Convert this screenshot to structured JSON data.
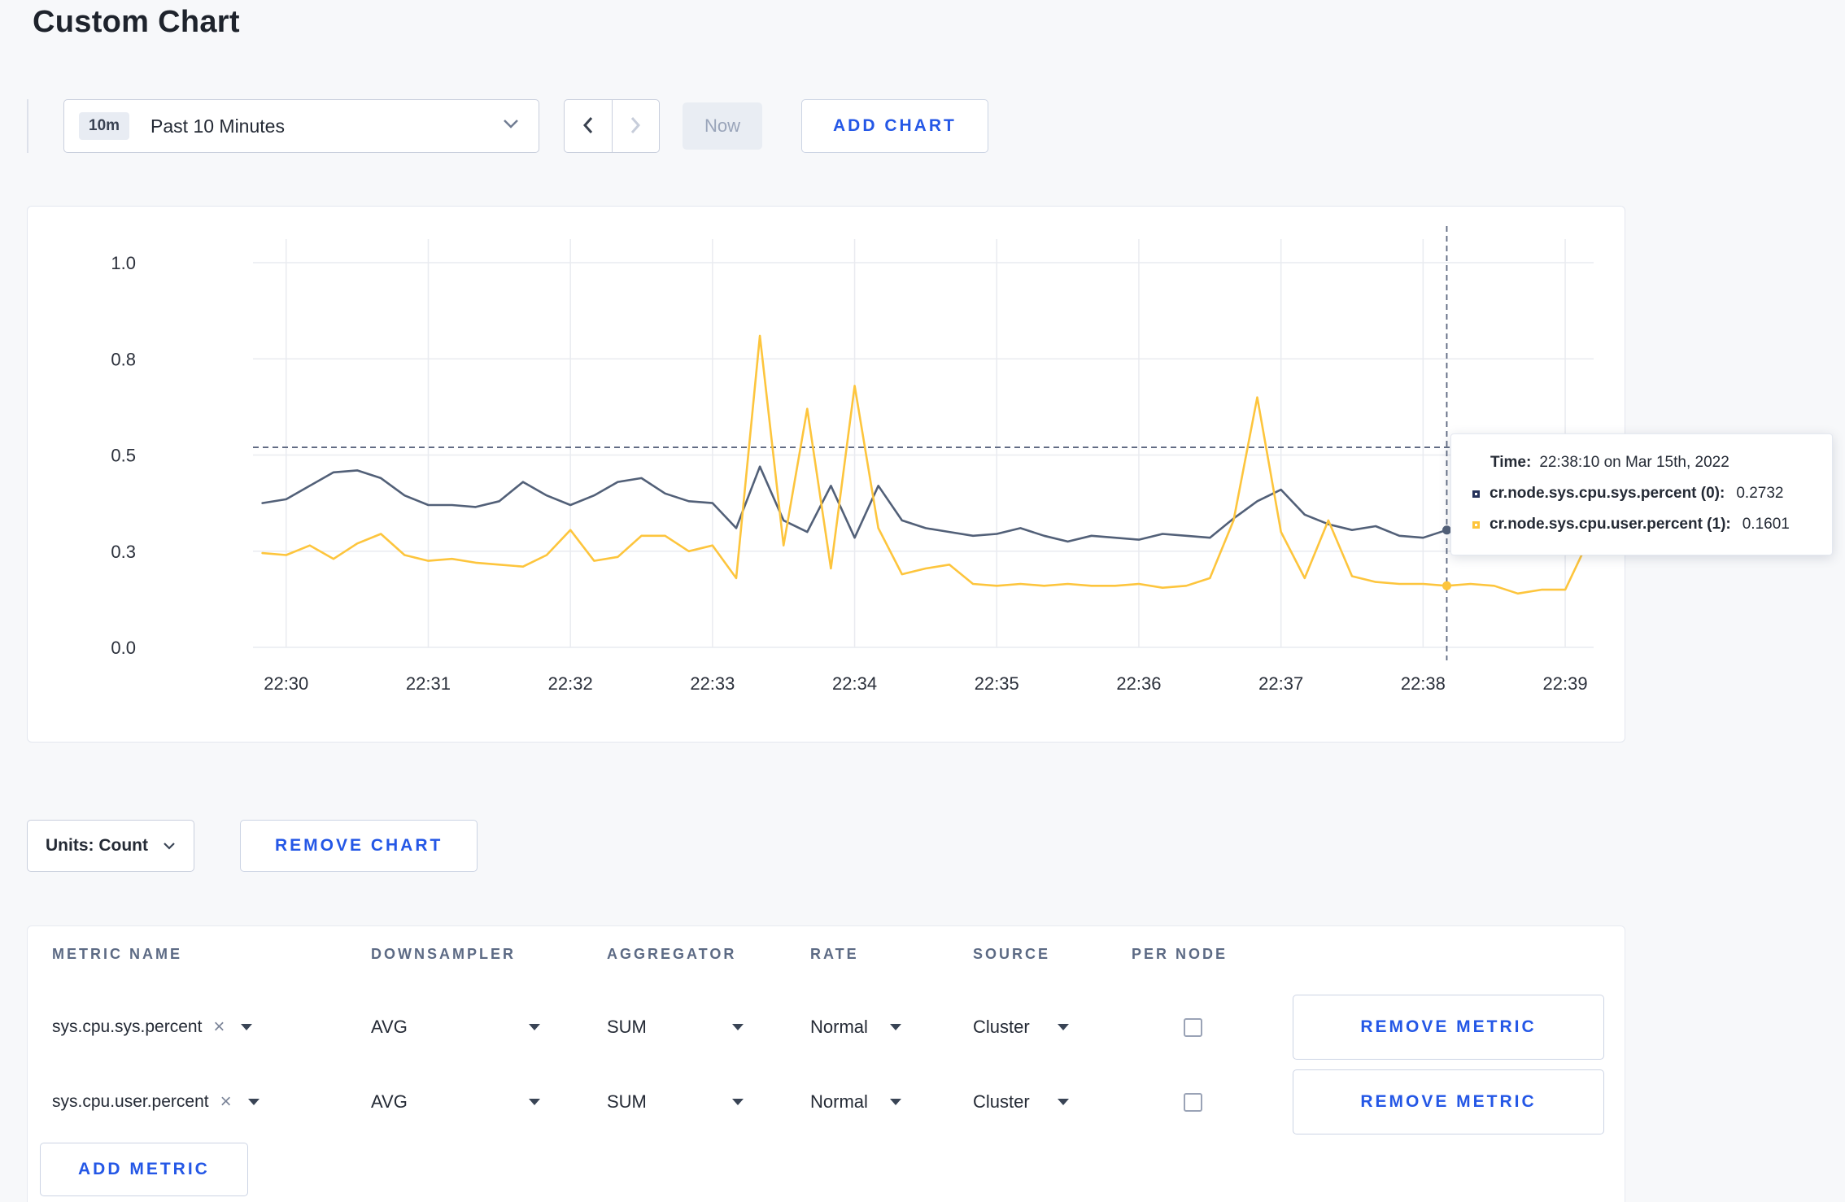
{
  "page": {
    "title": "Custom Chart"
  },
  "toolbar": {
    "time_range": {
      "badge": "10m",
      "label": "Past 10 Minutes"
    },
    "now_label": "Now",
    "add_chart_label": "ADD CHART"
  },
  "chart_data": {
    "type": "line",
    "xlim": [
      -14,
      552
    ],
    "ylim": [
      0,
      1
    ],
    "x_ticks": [
      {
        "s": 0,
        "label": "22:30"
      },
      {
        "s": 60,
        "label": "22:31"
      },
      {
        "s": 120,
        "label": "22:32"
      },
      {
        "s": 180,
        "label": "22:33"
      },
      {
        "s": 240,
        "label": "22:34"
      },
      {
        "s": 300,
        "label": "22:35"
      },
      {
        "s": 360,
        "label": "22:36"
      },
      {
        "s": 420,
        "label": "22:37"
      },
      {
        "s": 480,
        "label": "22:38"
      },
      {
        "s": 540,
        "label": "22:39"
      }
    ],
    "y_ticks": [
      {
        "v": 0.0,
        "label": "0.0"
      },
      {
        "v": 0.25,
        "label": "0.3"
      },
      {
        "v": 0.5,
        "label": "0.5"
      },
      {
        "v": 0.75,
        "label": "0.8"
      },
      {
        "v": 1.0,
        "label": "1.0"
      }
    ],
    "grid_color": "#e9ebf0",
    "tick_color": "#2b303b",
    "crosshair_color": "#5d6880",
    "crosshair_s": 490,
    "threshold_value": 0.52,
    "series": [
      {
        "name": "cr.node.sys.cpu.sys.percent",
        "color": "#526078",
        "points": [
          [
            -10,
            0.375
          ],
          [
            0,
            0.385
          ],
          [
            10,
            0.42
          ],
          [
            20,
            0.455
          ],
          [
            30,
            0.46
          ],
          [
            40,
            0.44
          ],
          [
            50,
            0.395
          ],
          [
            60,
            0.37
          ],
          [
            70,
            0.37
          ],
          [
            80,
            0.365
          ],
          [
            90,
            0.38
          ],
          [
            100,
            0.43
          ],
          [
            110,
            0.395
          ],
          [
            120,
            0.37
          ],
          [
            130,
            0.395
          ],
          [
            140,
            0.43
          ],
          [
            150,
            0.44
          ],
          [
            160,
            0.4
          ],
          [
            170,
            0.38
          ],
          [
            180,
            0.375
          ],
          [
            190,
            0.31
          ],
          [
            200,
            0.47
          ],
          [
            210,
            0.33
          ],
          [
            220,
            0.3
          ],
          [
            230,
            0.42
          ],
          [
            240,
            0.285
          ],
          [
            250,
            0.42
          ],
          [
            260,
            0.33
          ],
          [
            270,
            0.31
          ],
          [
            280,
            0.3
          ],
          [
            290,
            0.29
          ],
          [
            300,
            0.295
          ],
          [
            310,
            0.31
          ],
          [
            320,
            0.29
          ],
          [
            330,
            0.275
          ],
          [
            340,
            0.29
          ],
          [
            350,
            0.285
          ],
          [
            360,
            0.28
          ],
          [
            370,
            0.295
          ],
          [
            380,
            0.29
          ],
          [
            390,
            0.285
          ],
          [
            400,
            0.335
          ],
          [
            410,
            0.38
          ],
          [
            420,
            0.41
          ],
          [
            430,
            0.345
          ],
          [
            440,
            0.32
          ],
          [
            450,
            0.305
          ],
          [
            460,
            0.315
          ],
          [
            470,
            0.29
          ],
          [
            480,
            0.285
          ],
          [
            490,
            0.305
          ],
          [
            500,
            0.295
          ],
          [
            510,
            0.31
          ],
          [
            520,
            0.33
          ],
          [
            530,
            0.305
          ],
          [
            540,
            0.31
          ]
        ]
      },
      {
        "name": "cr.node.sys.cpu.user.percent",
        "color": "#fdc53d",
        "points": [
          [
            -10,
            0.245
          ],
          [
            0,
            0.24
          ],
          [
            10,
            0.265
          ],
          [
            20,
            0.23
          ],
          [
            30,
            0.27
          ],
          [
            40,
            0.295
          ],
          [
            50,
            0.24
          ],
          [
            60,
            0.225
          ],
          [
            70,
            0.23
          ],
          [
            80,
            0.22
          ],
          [
            90,
            0.215
          ],
          [
            100,
            0.21
          ],
          [
            110,
            0.24
          ],
          [
            120,
            0.305
          ],
          [
            130,
            0.225
          ],
          [
            140,
            0.235
          ],
          [
            150,
            0.29
          ],
          [
            160,
            0.29
          ],
          [
            170,
            0.25
          ],
          [
            180,
            0.265
          ],
          [
            190,
            0.18
          ],
          [
            200,
            0.81
          ],
          [
            210,
            0.265
          ],
          [
            220,
            0.62
          ],
          [
            230,
            0.205
          ],
          [
            240,
            0.68
          ],
          [
            250,
            0.31
          ],
          [
            260,
            0.19
          ],
          [
            270,
            0.205
          ],
          [
            280,
            0.215
          ],
          [
            290,
            0.165
          ],
          [
            300,
            0.16
          ],
          [
            310,
            0.165
          ],
          [
            320,
            0.16
          ],
          [
            330,
            0.165
          ],
          [
            340,
            0.16
          ],
          [
            350,
            0.16
          ],
          [
            360,
            0.165
          ],
          [
            370,
            0.155
          ],
          [
            380,
            0.16
          ],
          [
            390,
            0.18
          ],
          [
            400,
            0.33
          ],
          [
            410,
            0.65
          ],
          [
            420,
            0.3
          ],
          [
            430,
            0.18
          ],
          [
            440,
            0.33
          ],
          [
            450,
            0.185
          ],
          [
            460,
            0.17
          ],
          [
            470,
            0.165
          ],
          [
            480,
            0.165
          ],
          [
            490,
            0.1601
          ],
          [
            500,
            0.165
          ],
          [
            510,
            0.16
          ],
          [
            520,
            0.14
          ],
          [
            530,
            0.15
          ],
          [
            540,
            0.15
          ],
          [
            550,
            0.28
          ]
        ]
      }
    ],
    "hover_points": [
      {
        "series_index": 0,
        "s": 490,
        "v": 0.305
      },
      {
        "series_index": 1,
        "s": 490,
        "v": 0.1601
      }
    ]
  },
  "tooltip": {
    "time_label": "Time:",
    "time_value": "22:38:10 on Mar 15th, 2022",
    "rows": [
      {
        "name": "cr.node.sys.cpu.sys.percent (0):",
        "value": "0.2732",
        "color": "#26335b"
      },
      {
        "name": "cr.node.sys.cpu.user.percent (1):",
        "value": "0.1601",
        "color": "#fdc53d"
      }
    ]
  },
  "controls": {
    "units_label": "Units: Count",
    "remove_chart_label": "REMOVE CHART"
  },
  "metrics_table": {
    "headers": [
      "METRIC NAME",
      "DOWNSAMPLER",
      "AGGREGATOR",
      "RATE",
      "SOURCE",
      "PER NODE"
    ],
    "rows": [
      {
        "metric": "sys.cpu.sys.percent",
        "downsampler": "AVG",
        "aggregator": "SUM",
        "rate": "Normal",
        "source": "Cluster",
        "per_node_checked": false,
        "remove_label": "REMOVE METRIC"
      },
      {
        "metric": "sys.cpu.user.percent",
        "downsampler": "AVG",
        "aggregator": "SUM",
        "rate": "Normal",
        "source": "Cluster",
        "per_node_checked": false,
        "remove_label": "REMOVE METRIC"
      }
    ],
    "add_metric_label": "ADD METRIC"
  },
  "icons": {
    "close": "×"
  },
  "colors": {
    "accent_blue": "#2457e6",
    "page_bg": "#f7f8fa"
  }
}
